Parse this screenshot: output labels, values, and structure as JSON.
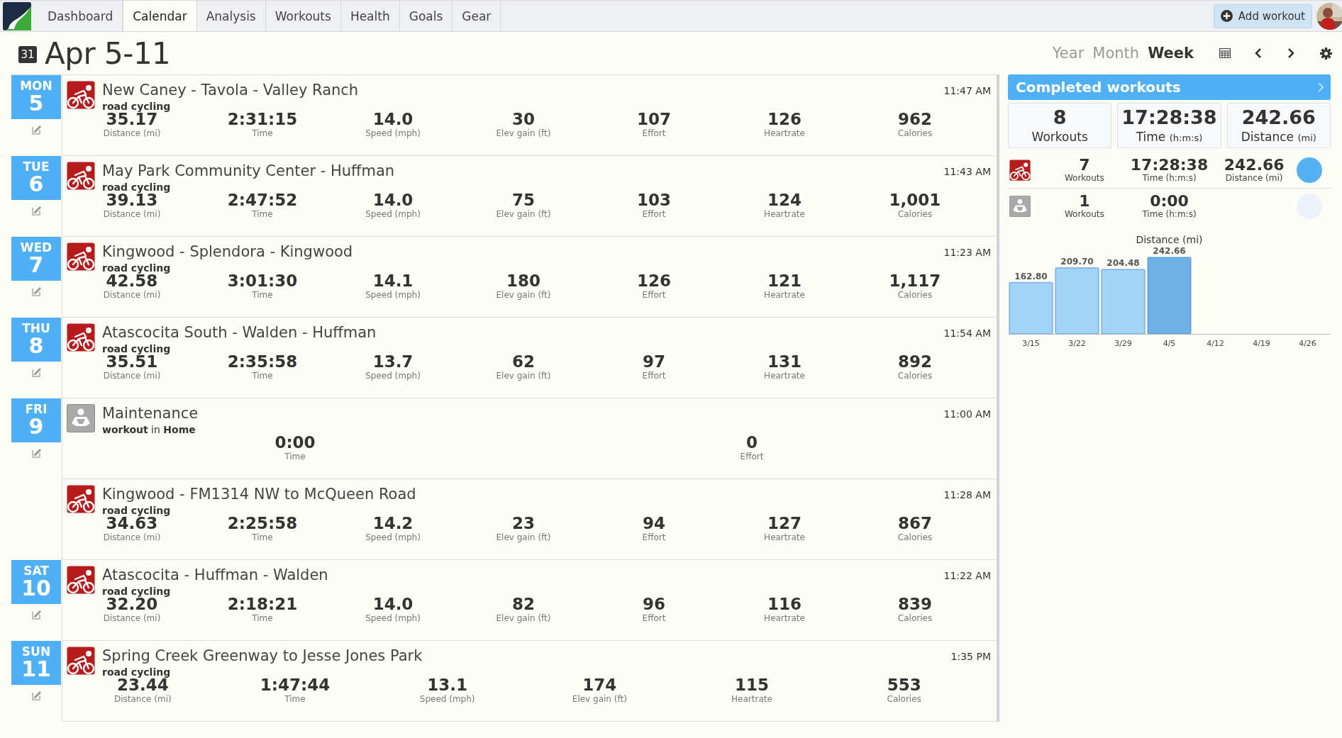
{
  "nav": {
    "tabs": [
      {
        "label": "Dashboard",
        "selected": false
      },
      {
        "label": "Calendar",
        "selected": true
      },
      {
        "label": "Analysis",
        "selected": false
      },
      {
        "label": "Workouts",
        "selected": false
      },
      {
        "label": "Health",
        "selected": false
      },
      {
        "label": "Goals",
        "selected": false
      },
      {
        "label": "Gear",
        "selected": false
      }
    ],
    "add_button": "Add workout"
  },
  "header": {
    "calendar_badge": "31",
    "title": "Apr 5-11",
    "views": [
      {
        "label": "Year",
        "selected": false
      },
      {
        "label": "Month",
        "selected": false
      },
      {
        "label": "Week",
        "selected": true
      }
    ]
  },
  "days": [
    {
      "weekday": "MON",
      "date": "5",
      "workouts": [
        {
          "kind": "cycling",
          "title": "New Caney - Tavola - Valley Ranch",
          "sport": "road cycling",
          "time": "11:47 AM",
          "stats": [
            {
              "value": "35.17",
              "label": "Distance (mi)"
            },
            {
              "value": "2:31:15",
              "label": "Time"
            },
            {
              "value": "14.0",
              "label": "Speed (mph)"
            },
            {
              "value": "30",
              "label": "Elev gain (ft)"
            },
            {
              "value": "107",
              "label": "Effort"
            },
            {
              "value": "126",
              "label": "Heartrate"
            },
            {
              "value": "962",
              "label": "Calories"
            }
          ]
        }
      ]
    },
    {
      "weekday": "TUE",
      "date": "6",
      "workouts": [
        {
          "kind": "cycling",
          "title": "May Park Community Center - Huffman",
          "sport": "road cycling",
          "time": "11:43 AM",
          "stats": [
            {
              "value": "39.13",
              "label": "Distance (mi)"
            },
            {
              "value": "2:47:52",
              "label": "Time"
            },
            {
              "value": "14.0",
              "label": "Speed (mph)"
            },
            {
              "value": "75",
              "label": "Elev gain (ft)"
            },
            {
              "value": "103",
              "label": "Effort"
            },
            {
              "value": "124",
              "label": "Heartrate"
            },
            {
              "value": "1,001",
              "label": "Calories"
            }
          ]
        }
      ]
    },
    {
      "weekday": "WED",
      "date": "7",
      "workouts": [
        {
          "kind": "cycling",
          "title": "Kingwood - Splendora - Kingwood",
          "sport": "road cycling",
          "time": "11:23 AM",
          "stats": [
            {
              "value": "42.58",
              "label": "Distance (mi)"
            },
            {
              "value": "3:01:30",
              "label": "Time"
            },
            {
              "value": "14.1",
              "label": "Speed (mph)"
            },
            {
              "value": "180",
              "label": "Elev gain (ft)"
            },
            {
              "value": "126",
              "label": "Effort"
            },
            {
              "value": "121",
              "label": "Heartrate"
            },
            {
              "value": "1,117",
              "label": "Calories"
            }
          ]
        }
      ]
    },
    {
      "weekday": "THU",
      "date": "8",
      "workouts": [
        {
          "kind": "cycling",
          "title": "Atascocita South - Walden - Huffman",
          "sport": "road cycling",
          "time": "11:54 AM",
          "stats": [
            {
              "value": "35.51",
              "label": "Distance (mi)"
            },
            {
              "value": "2:35:58",
              "label": "Time"
            },
            {
              "value": "13.7",
              "label": "Speed (mph)"
            },
            {
              "value": "62",
              "label": "Elev gain (ft)"
            },
            {
              "value": "97",
              "label": "Effort"
            },
            {
              "value": "131",
              "label": "Heartrate"
            },
            {
              "value": "892",
              "label": "Calories"
            }
          ]
        }
      ]
    },
    {
      "weekday": "FRI",
      "date": "9",
      "workouts": [
        {
          "kind": "maintenance",
          "title": "Maintenance",
          "sport": "workout",
          "place": "in **Home**",
          "time": "11:00 AM",
          "stats": [
            {
              "value": "0:00",
              "label": "Time"
            },
            {
              "value": "0",
              "label": "Effort"
            }
          ]
        },
        {
          "kind": "cycling",
          "title": "Kingwood - FM1314 NW to McQueen Road",
          "sport": "road cycling",
          "time": "11:28 AM",
          "stats": [
            {
              "value": "34.63",
              "label": "Distance (mi)"
            },
            {
              "value": "2:25:58",
              "label": "Time"
            },
            {
              "value": "14.2",
              "label": "Speed (mph)"
            },
            {
              "value": "23",
              "label": "Elev gain (ft)"
            },
            {
              "value": "94",
              "label": "Effort"
            },
            {
              "value": "127",
              "label": "Heartrate"
            },
            {
              "value": "867",
              "label": "Calories"
            }
          ]
        }
      ]
    },
    {
      "weekday": "SAT",
      "date": "10",
      "workouts": [
        {
          "kind": "cycling",
          "title": "Atascocita - Huffman - Walden",
          "sport": "road cycling",
          "time": "11:22 AM",
          "stats": [
            {
              "value": "32.20",
              "label": "Distance (mi)"
            },
            {
              "value": "2:18:21",
              "label": "Time"
            },
            {
              "value": "14.0",
              "label": "Speed (mph)"
            },
            {
              "value": "82",
              "label": "Elev gain (ft)"
            },
            {
              "value": "96",
              "label": "Effort"
            },
            {
              "value": "116",
              "label": "Heartrate"
            },
            {
              "value": "839",
              "label": "Calories"
            }
          ]
        }
      ]
    },
    {
      "weekday": "SUN",
      "date": "11",
      "workouts": [
        {
          "kind": "cycling",
          "title": "Spring Creek Greenway to Jesse Jones Park",
          "sport": "road cycling",
          "time": "1:35 PM",
          "stats": [
            {
              "value": "23.44",
              "label": "Distance (mi)"
            },
            {
              "value": "1:47:44",
              "label": "Time"
            },
            {
              "value": "13.1",
              "label": "Speed (mph)"
            },
            {
              "value": "174",
              "label": "Elev gain (ft)"
            },
            {
              "value": "115",
              "label": "Heartrate"
            },
            {
              "value": "553",
              "label": "Calories"
            }
          ]
        }
      ]
    }
  ],
  "summary": {
    "title": "Completed workouts",
    "totals": [
      {
        "value": "8",
        "label": "Workouts"
      },
      {
        "value": "17:28:38",
        "label": "Time",
        "unit": "(h:m:s)"
      },
      {
        "value": "242.66",
        "label": "Distance",
        "unit": "(mi)"
      }
    ],
    "sports": [
      {
        "kind": "cycling",
        "color": "#55b1f2",
        "stats": [
          {
            "value": "7",
            "label": "Workouts"
          },
          {
            "value": "17:28:38",
            "label": "Time (h:m:s)"
          },
          {
            "value": "242.66",
            "label": "Distance (mi)"
          }
        ]
      },
      {
        "kind": "maintenance",
        "color": "#eef2fb",
        "stats": [
          {
            "value": "1",
            "label": "Workouts"
          },
          {
            "value": "0:00",
            "label": "Time (h:m:s)"
          }
        ]
      }
    ],
    "chart_data": {
      "type": "bar",
      "title": "Distance (mi)",
      "categories": [
        "3/15",
        "3/22",
        "3/29",
        "4/5",
        "4/12",
        "4/19",
        "4/26"
      ],
      "series": [
        {
          "color": "#a2d4f7",
          "values": [
            162.8,
            209.7,
            204.48,
            null,
            null,
            null,
            null
          ],
          "value_labels": [
            "162.80",
            "209.70",
            "204.48",
            null,
            null,
            null,
            null
          ]
        },
        {
          "color": "#6fb0e6",
          "values": [
            null,
            null,
            null,
            242.66,
            null,
            null,
            null
          ],
          "value_labels": [
            null,
            null,
            null,
            "242.66",
            null,
            null,
            null
          ]
        }
      ]
    }
  }
}
